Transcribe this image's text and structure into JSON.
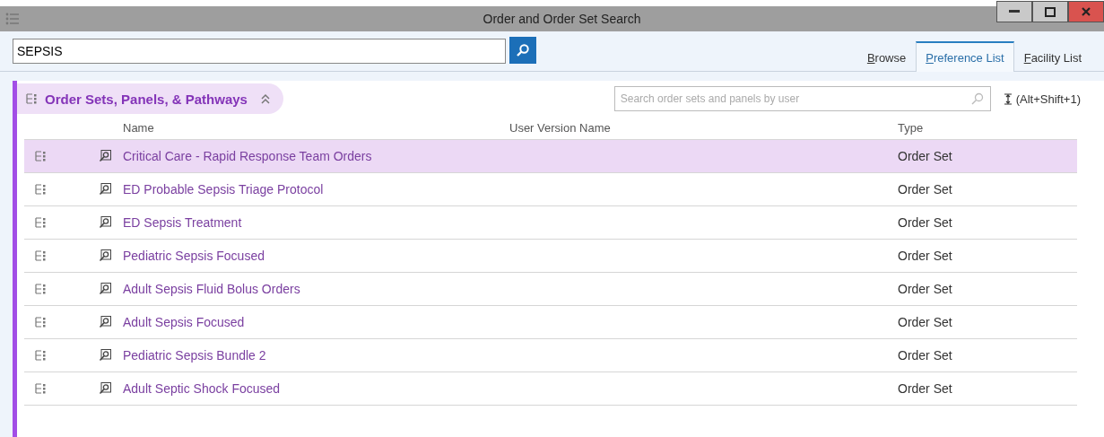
{
  "window": {
    "title": "Order and Order Set Search"
  },
  "search": {
    "value": "SEPSIS"
  },
  "tabs": [
    {
      "label": "Browse",
      "selected": false
    },
    {
      "label": "Preference List",
      "selected": true
    },
    {
      "label": "Facility List",
      "selected": false
    }
  ],
  "section": {
    "title": "Order Sets, Panels, & Pathways",
    "expanded": true,
    "user_search": {
      "placeholder": "Search order sets and panels by user"
    },
    "shortcut": "(Alt+Shift+1)"
  },
  "table": {
    "columns": [
      "Name",
      "User Version Name",
      "Type"
    ],
    "rows": [
      {
        "name": "Critical Care - Rapid Response Team Orders",
        "type": "Order Set",
        "selected": true
      },
      {
        "name": "ED Probable Sepsis Triage Protocol",
        "type": "Order Set",
        "selected": false
      },
      {
        "name": "ED Sepsis Treatment",
        "type": "Order Set",
        "selected": false
      },
      {
        "name": "Pediatric Sepsis Focused",
        "type": "Order Set",
        "selected": false
      },
      {
        "name": "Adult Sepsis Fluid Bolus Orders",
        "type": "Order Set",
        "selected": false
      },
      {
        "name": "Adult Sepsis Focused",
        "type": "Order Set",
        "selected": false
      },
      {
        "name": "Pediatric Sepsis Bundle 2",
        "type": "Order Set",
        "selected": false
      },
      {
        "name": "Adult Septic Shock Focused",
        "type": "Order Set",
        "selected": false
      }
    ]
  }
}
